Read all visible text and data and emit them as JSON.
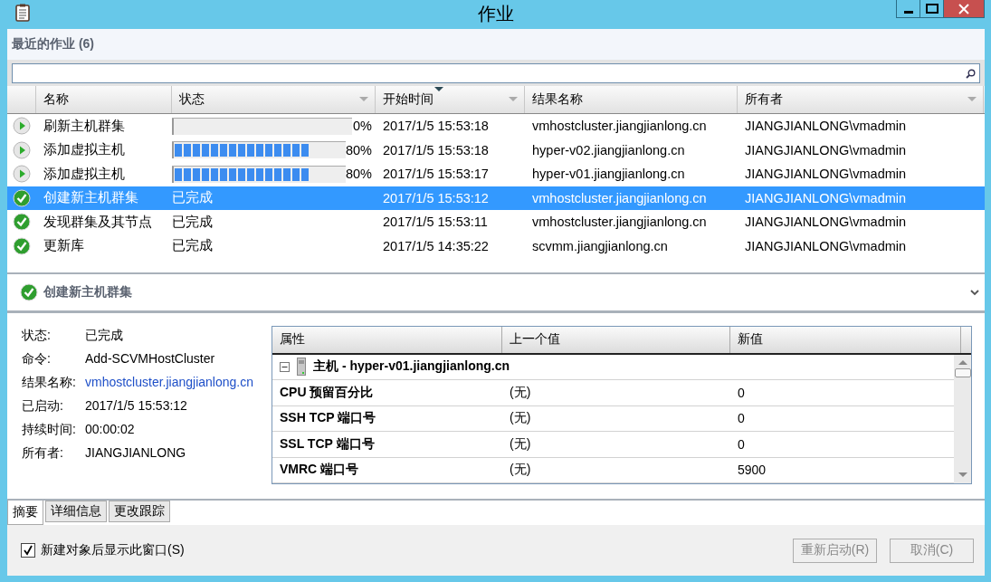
{
  "window": {
    "title": "作业"
  },
  "recent_jobs": {
    "title": "最近的作业 (6)",
    "columns": [
      {
        "label": "名称",
        "filter": false,
        "sorted": false
      },
      {
        "label": "状态",
        "filter": true,
        "sorted": false
      },
      {
        "label": "开始时间",
        "filter": true,
        "sorted": true
      },
      {
        "label": "结果名称",
        "filter": false,
        "sorted": false
      },
      {
        "label": "所有者",
        "filter": true,
        "sorted": false
      }
    ],
    "rows": [
      {
        "kind": "running",
        "name": "刷新主机群集",
        "progress": {
          "level": 0,
          "reading": "0%"
        },
        "start": "2017/1/5 15:53:18",
        "result": "vmhostcluster.jiangjianlong.cn",
        "owner": "JIANGJIANLONG\\vmadmin",
        "selected": false
      },
      {
        "kind": "running",
        "name": "添加虚拟主机",
        "progress": {
          "level": 0.8,
          "reading": "80%"
        },
        "start": "2017/1/5 15:53:18",
        "result": "hyper-v02.jiangjianlong.cn",
        "owner": "JIANGJIANLONG\\vmadmin",
        "selected": false
      },
      {
        "kind": "running",
        "name": "添加虚拟主机",
        "progress": {
          "level": 0.8,
          "reading": "80%"
        },
        "start": "2017/1/5 15:53:17",
        "result": "hyper-v01.jiangjianlong.cn",
        "owner": "JIANGJIANLONG\\vmadmin",
        "selected": false
      },
      {
        "kind": "completed",
        "name": "创建新主机群集",
        "status": "已完成",
        "start": "2017/1/5 15:53:12",
        "result": "vmhostcluster.jiangjianlong.cn",
        "owner": "JIANGJIANLONG\\vmadmin",
        "selected": true
      },
      {
        "kind": "completed",
        "name": "发现群集及其节点",
        "status": "已完成",
        "start": "2017/1/5 15:53:11",
        "result": "vmhostcluster.jiangjianlong.cn",
        "owner": "JIANGJIANLONG\\vmadmin",
        "selected": false
      },
      {
        "kind": "completed",
        "name": "更新库",
        "status": "已完成",
        "start": "2017/1/5 14:35:22",
        "result": "scvmm.jiangjianlong.cn",
        "owner": "JIANGJIANLONG\\vmadmin",
        "selected": false
      }
    ]
  },
  "detail": {
    "kind": "completed",
    "title": "创建新主机群集",
    "summary": [
      {
        "label": "状态:",
        "value": "已完成",
        "kind": "text"
      },
      {
        "label": "命令:",
        "value": "Add-SCVMHostCluster",
        "kind": "text"
      },
      {
        "label": "结果名称:",
        "value": "vmhostcluster.jiangjianlong.cn",
        "kind": "link"
      },
      {
        "label": "已启动:",
        "value": "2017/1/5 15:53:12",
        "kind": "text"
      },
      {
        "label": "持续时间:",
        "value": "00:00:02",
        "kind": "text"
      },
      {
        "label": "所有者:",
        "value": "JIANGJIANLONG",
        "kind": "text"
      }
    ],
    "properties": {
      "columns": [
        "属性",
        "上一个值",
        "新值"
      ],
      "group": {
        "label": "主机 - hyper-v01.jiangjianlong.cn",
        "expanded": true
      },
      "rows": [
        {
          "property": "CPU 预留百分比",
          "previous": "(无)",
          "new": "0"
        },
        {
          "property": "SSH TCP 端口号",
          "previous": "(无)",
          "new": "0"
        },
        {
          "property": "SSL TCP 端口号",
          "previous": "(无)",
          "new": "0"
        },
        {
          "property": "VMRC 端口号",
          "previous": "(无)",
          "new": "5900"
        }
      ]
    }
  },
  "tabs": [
    {
      "label": "摘要",
      "selected": true
    },
    {
      "label": "详细信息",
      "selected": false
    },
    {
      "label": "更改跟踪",
      "selected": false
    }
  ],
  "show_after_create": {
    "label": "新建对象后显示此窗口(S)",
    "checked": true
  },
  "buttons": [
    {
      "label": "重新启动(R)",
      "disabled": true
    },
    {
      "label": "取消(C)",
      "disabled": true
    }
  ]
}
